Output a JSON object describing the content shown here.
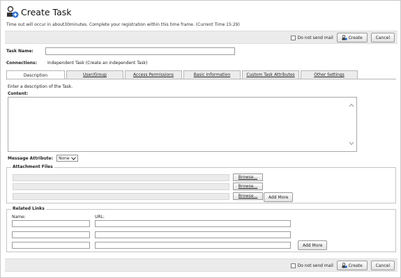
{
  "header": {
    "title": "Create Task",
    "icon": "task-create-icon",
    "timeout_notice": "Time out will occur in about30minutes. Complete your registration within this time frame. (Current Time 15:29)"
  },
  "toolbar": {
    "do_not_send_mail_label": "Do not send mail",
    "create_label": "Create",
    "cancel_label": "Cancel"
  },
  "form": {
    "task_name_label": "Task Name:",
    "task_name_value": "",
    "connections_label": "Connections:",
    "connections_value": "Independent Task (Create an independent Task)"
  },
  "tabs": [
    {
      "label": "Description",
      "active": true
    },
    {
      "label": "User/Group",
      "active": false
    },
    {
      "label": "Access Permissions",
      "active": false
    },
    {
      "label": "Basic Information",
      "active": false
    },
    {
      "label": "Custom Task Attributes",
      "active": false
    },
    {
      "label": "Other Settings",
      "active": false
    }
  ],
  "description": {
    "intro": "Enter a description of the Task.",
    "content_label": "Content:",
    "content_value": ""
  },
  "message_attribute": {
    "label": "Message Attribute:",
    "selected": "None"
  },
  "attachments": {
    "legend": "Attachment Files",
    "browse_label": "Browse...",
    "add_more_label": "Add More"
  },
  "related_links": {
    "legend": "Related Links",
    "name_header": "Name:",
    "url_header": "URL:",
    "add_more_label": "Add More"
  }
}
